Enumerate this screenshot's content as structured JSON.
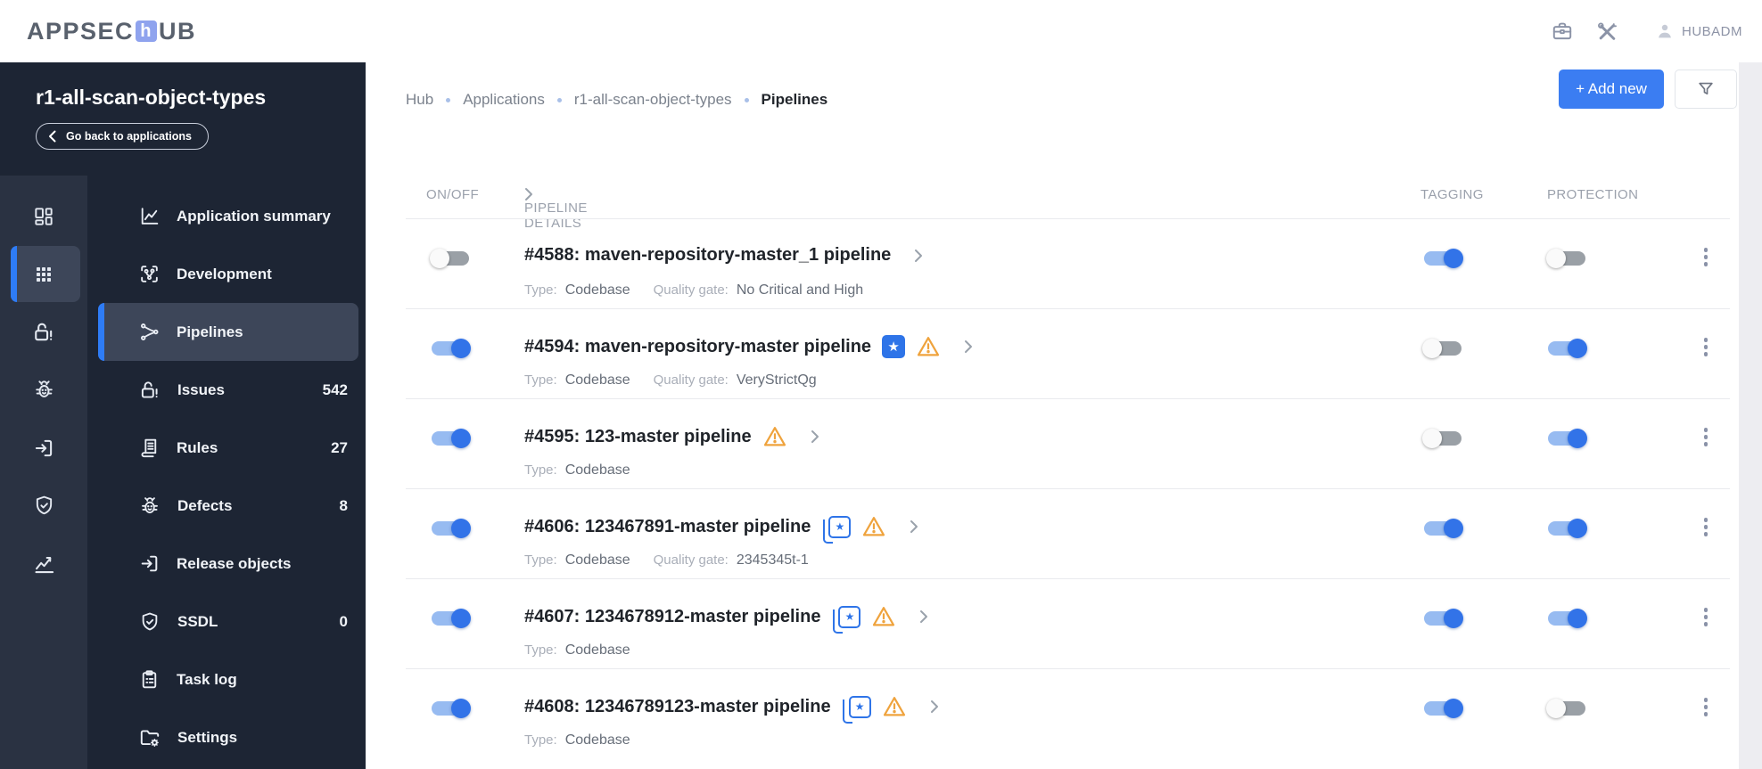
{
  "app": {
    "logo": {
      "prefix": "APPSEC",
      "mid": "h",
      "suffix": "UB"
    },
    "user": "HUBADM",
    "header_icons": [
      "briefcase-icon",
      "tools-icon",
      "user-icon"
    ]
  },
  "colors": {
    "accent_blue": "#2e7cf6",
    "toggle_on_thumb": "#3273e8",
    "toggle_on_track": "#97bbf1",
    "sidebar_dark": "#1d2534",
    "rail_dark": "#2a3242",
    "active_item": "#3d4659",
    "warning_orange": "#efa33d",
    "logo_square": "#8fa3ee"
  },
  "sidebar": {
    "app_title": "r1-all-scan-object-types",
    "back_button": "Go back to applications",
    "rail_icons": [
      "dashboard-icon",
      "apps-grid-icon",
      "lock-alert-icon",
      "bug-icon",
      "release-icon",
      "shield-check-icon",
      "analytics-icon"
    ],
    "rail_active_index": 1,
    "items": [
      {
        "label": "Application summary",
        "icon": "chart-line-icon",
        "count": null,
        "active": false
      },
      {
        "label": "Development",
        "icon": "dev-branch-icon",
        "count": null,
        "active": false
      },
      {
        "label": "Pipelines",
        "icon": "pipeline-fork-icon",
        "count": null,
        "active": true
      },
      {
        "label": "Issues",
        "icon": "lock-alert-icon",
        "count": "542",
        "active": false
      },
      {
        "label": "Rules",
        "icon": "scroll-icon",
        "count": "27",
        "active": false
      },
      {
        "label": "Defects",
        "icon": "bug-icon",
        "count": "8",
        "active": false
      },
      {
        "label": "Release objects",
        "icon": "release-icon",
        "count": null,
        "active": false
      },
      {
        "label": "SSDL",
        "icon": "shield-check-icon",
        "count": "0",
        "active": false
      },
      {
        "label": "Task log",
        "icon": "clipboard-list-icon",
        "count": null,
        "active": false
      },
      {
        "label": "Settings",
        "icon": "folder-gear-icon",
        "count": null,
        "active": false
      }
    ]
  },
  "breadcrumb": {
    "items": [
      "Hub",
      "Applications",
      "r1-all-scan-object-types",
      "Pipelines"
    ]
  },
  "toolbar": {
    "add_new": "+ Add new",
    "filter_icon": "filter-icon"
  },
  "table": {
    "columns": {
      "on_off": "ON/OFF",
      "details": "PIPELINE DETAILS",
      "tagging": "TAGGING",
      "protection": "PROTECTION"
    },
    "labels": {
      "type": "Type:",
      "quality_gate": "Quality gate:"
    },
    "star_glyph": "★",
    "rows": [
      {
        "title": "#4588: maven-repository-master_1 pipeline",
        "enabled": false,
        "badges": [],
        "type": "Codebase",
        "quality_gate": "No Critical and High",
        "tagging": true,
        "protection": false
      },
      {
        "title": "#4594: maven-repository-master pipeline",
        "enabled": true,
        "badges": [
          "starred-icon",
          "warning-icon"
        ],
        "type": "Codebase",
        "quality_gate": "VeryStrictQg",
        "tagging": false,
        "protection": true
      },
      {
        "title": "#4595: 123-master pipeline",
        "enabled": true,
        "badges": [
          "warning-icon"
        ],
        "type": "Codebase",
        "quality_gate": null,
        "tagging": false,
        "protection": true
      },
      {
        "title": "#4606: 123467891-master pipeline",
        "enabled": true,
        "badges": [
          "starred-stack-icon",
          "warning-icon"
        ],
        "type": "Codebase",
        "quality_gate": "2345345t-1",
        "tagging": true,
        "protection": true
      },
      {
        "title": "#4607: 1234678912-master pipeline",
        "enabled": true,
        "badges": [
          "starred-stack-icon",
          "warning-icon"
        ],
        "type": "Codebase",
        "quality_gate": null,
        "tagging": true,
        "protection": true
      },
      {
        "title": "#4608: 12346789123-master pipeline",
        "enabled": true,
        "badges": [
          "starred-stack-icon",
          "warning-icon"
        ],
        "type": "Codebase",
        "quality_gate": null,
        "tagging": true,
        "protection": false
      }
    ]
  }
}
